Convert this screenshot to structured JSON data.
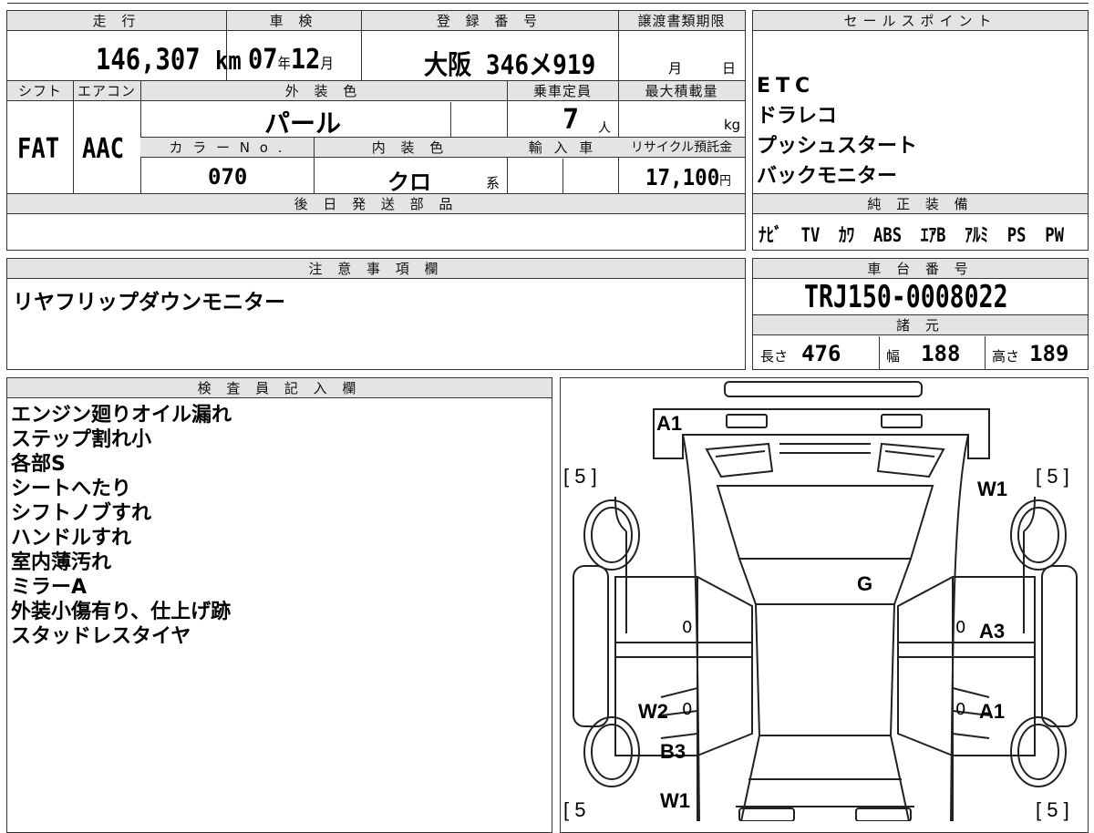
{
  "top": {
    "mileage_label": "走 行",
    "mileage_value": "146,307",
    "mileage_unit": "km",
    "inspection_label": "車 検",
    "inspection_year": "07",
    "inspection_year_unit": "年",
    "inspection_month": "12",
    "inspection_month_unit": "月",
    "reg_label": "登 録 番 号",
    "reg_value": "大阪 346メ919",
    "transfer_label": "譲渡書類期限",
    "transfer_month_unit": "月",
    "transfer_day_unit": "日"
  },
  "second": {
    "shift_label": "シフト",
    "shift_value": "FAT",
    "ac_label": "エアコン",
    "ac_value": "AAC",
    "exterior_label": "外 装 色",
    "exterior_value": "パール",
    "capacity_label": "乗車定員",
    "capacity_value": "7",
    "capacity_unit": "人",
    "max_load_label": "最大積載量",
    "max_load_unit": "kg",
    "color_no_label": "カ ラ ー N o .",
    "color_no_value": "070",
    "interior_label": "内 装 色",
    "interior_value": "クロ",
    "interior_suffix": "系",
    "import_label": "輸 入 車",
    "recycle_label": "リサイクル預託金",
    "recycle_value": "17,100",
    "recycle_unit": "円"
  },
  "later_parts": {
    "label": "後 日 発 送 部 品"
  },
  "sales_points": {
    "label": "セールスポイント",
    "items": [
      "ETC",
      "ドラレコ",
      "プッシュスタート",
      "バックモニター"
    ]
  },
  "genuine_equipment": {
    "label": "純 正 装 備",
    "items": [
      "ﾅﾋﾞ",
      "TV",
      "ｶﾜ",
      "ABS",
      "ｴｱB",
      "ｱﾙﾐ",
      "PS",
      "PW"
    ]
  },
  "notes": {
    "label": "注 意 事 項 欄",
    "text": "リヤフリップダウンモニター"
  },
  "chassis": {
    "label": "車 台 番 号",
    "value": "TRJ150-0008022"
  },
  "specs": {
    "label": "諸 元",
    "length_label": "長さ",
    "length_value": "476",
    "width_label": "幅",
    "width_value": "188",
    "height_label": "高さ",
    "height_value": "189"
  },
  "inspector": {
    "label": "検 査 員 記 入 欄",
    "lines": [
      "エンジン廻りオイル漏れ",
      "ステップ割れ小",
      "各部S",
      "シートへたり",
      "シフトノブすれ",
      "ハンドルすれ",
      "室内薄汚れ",
      "ミラーA",
      "外装小傷有り、仕上げ跡",
      "スタッドレスタイヤ"
    ]
  },
  "diagram": {
    "front_bumper": "A1",
    "windshield": "G",
    "front_right_wheel": "W1",
    "right_front_door": "A3",
    "right_rear_door": "A1",
    "left_rear_door_a": "W2",
    "left_rear_door_b": "B3",
    "left_rear_wheel": "W1",
    "tire_tl": "[ 5 ]",
    "tire_tr": "[ 5 ]",
    "tire_bl": "[ 5",
    "tire_br": "[ 5 ]",
    "zero_marks": [
      "0",
      "0",
      "0",
      "0"
    ]
  }
}
